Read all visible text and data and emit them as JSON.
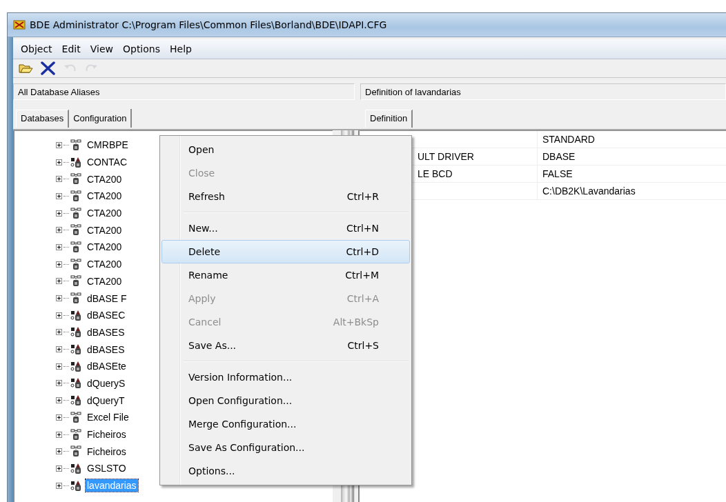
{
  "window": {
    "title": "BDE Administrator  C:\\Program Files\\Common Files\\Borland\\BDE\\IDAPI.CFG"
  },
  "menu_bar": [
    "Object",
    "Edit",
    "View",
    "Options",
    "Help"
  ],
  "toolbar": [
    {
      "kind": "open",
      "disabled": false
    },
    {
      "kind": "delete",
      "disabled": false
    },
    {
      "kind": "undo",
      "disabled": true
    },
    {
      "kind": "redo",
      "disabled": true
    }
  ],
  "left_panel": {
    "header": "All Database Aliases",
    "tabs": [
      {
        "label": "Databases",
        "selected": true
      },
      {
        "label": "Configuration",
        "selected": false
      }
    ],
    "tree": [
      {
        "label": "CMRBPE",
        "kind": "standard",
        "selected": false
      },
      {
        "label": "CONTAC",
        "kind": "sql",
        "selected": false
      },
      {
        "label": "CTA200",
        "kind": "standard",
        "selected": false
      },
      {
        "label": "CTA200",
        "kind": "standard",
        "selected": false
      },
      {
        "label": "CTA200",
        "kind": "standard",
        "selected": false
      },
      {
        "label": "CTA200",
        "kind": "standard",
        "selected": false
      },
      {
        "label": "CTA200",
        "kind": "standard",
        "selected": false
      },
      {
        "label": "CTA200",
        "kind": "standard",
        "selected": false
      },
      {
        "label": "CTA200",
        "kind": "standard",
        "selected": false
      },
      {
        "label": "dBASE F",
        "kind": "standard",
        "selected": false
      },
      {
        "label": "dBASEC",
        "kind": "sql",
        "selected": false
      },
      {
        "label": "dBASES",
        "kind": "sql",
        "selected": false
      },
      {
        "label": "dBASES",
        "kind": "sql",
        "selected": false
      },
      {
        "label": "dBASEte",
        "kind": "sql",
        "selected": false
      },
      {
        "label": "dQueryS",
        "kind": "sql",
        "selected": false
      },
      {
        "label": "dQueryT",
        "kind": "sql",
        "selected": false
      },
      {
        "label": "Excel File",
        "kind": "standard",
        "selected": false
      },
      {
        "label": "Ficheiros",
        "kind": "standard",
        "selected": false
      },
      {
        "label": "Ficheiros",
        "kind": "standard",
        "selected": false
      },
      {
        "label": "GSLSTO",
        "kind": "sql",
        "selected": false
      },
      {
        "label": "lavandarias",
        "kind": "sql",
        "selected": true
      }
    ]
  },
  "right_panel": {
    "header": "Definition of lavandarias",
    "tabs": [
      {
        "label": "Definition",
        "selected": true
      }
    ],
    "rows": [
      {
        "name": "",
        "value": "STANDARD"
      },
      {
        "name": "ULT DRIVER",
        "value": "DBASE"
      },
      {
        "name": "LE BCD",
        "value": "FALSE"
      },
      {
        "name": "",
        "value": "C:\\DB2K\\Lavandarias"
      }
    ]
  },
  "context_menu": [
    {
      "kind": "item",
      "label": "Open",
      "disabled": false,
      "selected": false
    },
    {
      "kind": "item",
      "label": "Close",
      "disabled": true,
      "selected": false
    },
    {
      "kind": "item",
      "label": "Refresh",
      "shortcut": "Ctrl+R",
      "disabled": false,
      "selected": false
    },
    {
      "kind": "separator"
    },
    {
      "kind": "item",
      "label": "New...",
      "shortcut": "Ctrl+N",
      "disabled": false,
      "selected": false
    },
    {
      "kind": "item",
      "label": "Delete",
      "shortcut": "Ctrl+D",
      "disabled": false,
      "selected": true
    },
    {
      "kind": "item",
      "label": "Rename",
      "shortcut": "Ctrl+M",
      "disabled": false,
      "selected": false
    },
    {
      "kind": "item",
      "label": "Apply",
      "shortcut": "Ctrl+A",
      "disabled": true,
      "selected": false
    },
    {
      "kind": "item",
      "label": "Cancel",
      "shortcut": "Alt+BkSp",
      "disabled": true,
      "selected": false
    },
    {
      "kind": "item",
      "label": "Save As...",
      "shortcut": "Ctrl+S",
      "disabled": false,
      "selected": false
    },
    {
      "kind": "separator"
    },
    {
      "kind": "item",
      "label": "Version Information...",
      "disabled": false,
      "selected": false
    },
    {
      "kind": "item",
      "label": "Open Configuration...",
      "disabled": false,
      "selected": false
    },
    {
      "kind": "item",
      "label": "Merge Configuration...",
      "disabled": false,
      "selected": false
    },
    {
      "kind": "item",
      "label": "Save As Configuration...",
      "disabled": false,
      "selected": false
    },
    {
      "kind": "item",
      "label": "Options...",
      "disabled": false,
      "selected": false
    }
  ]
}
